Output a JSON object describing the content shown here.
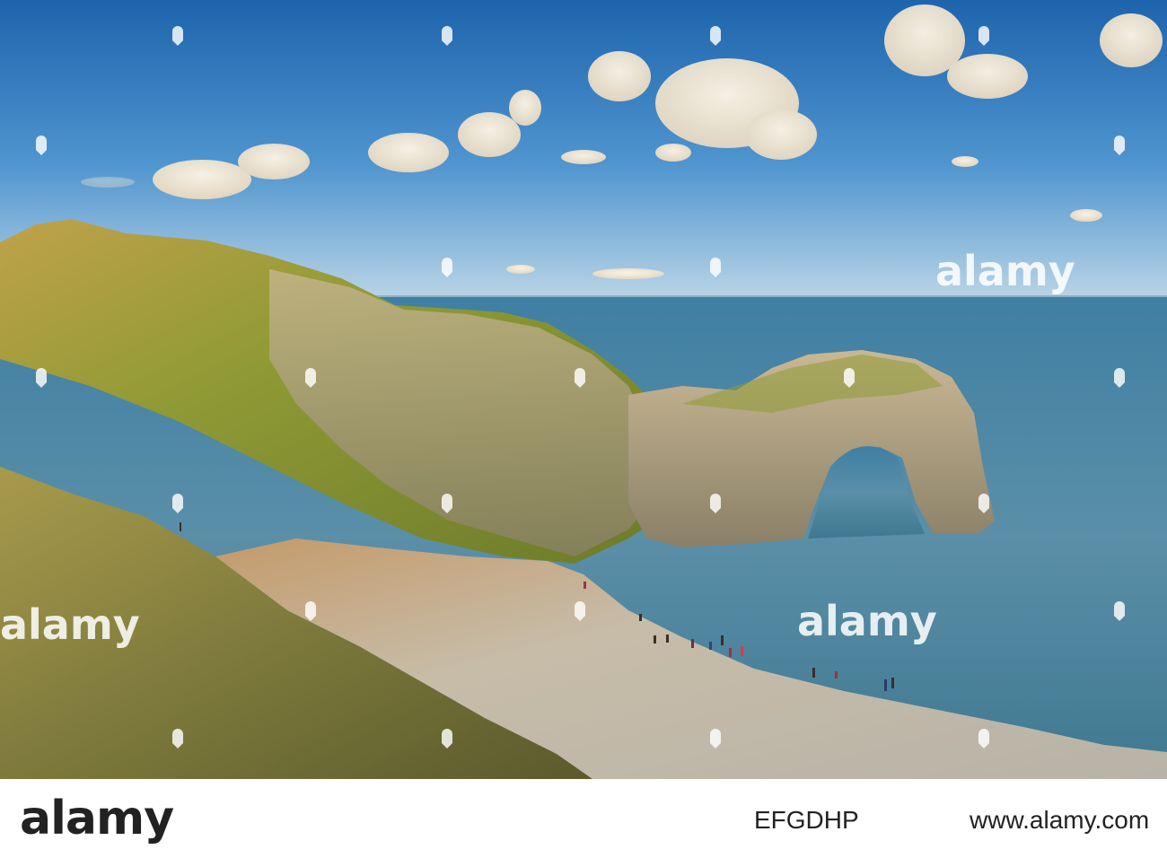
{
  "watermark": {
    "brand": "alamy",
    "icon": "alamy-pin-icon",
    "color": "#ffffff"
  },
  "footer": {
    "logo": "alamy",
    "image_id": "EFGDHP",
    "domain": "www.alamy.com"
  },
  "colors": {
    "sky_top": "#1e6bb3",
    "sky_horizon": "#b8d3e6",
    "sea": "#4f86a3",
    "cliff_grass": "#9aa63a",
    "rock": "#b9ab8c",
    "beach": "#c9bfae"
  }
}
